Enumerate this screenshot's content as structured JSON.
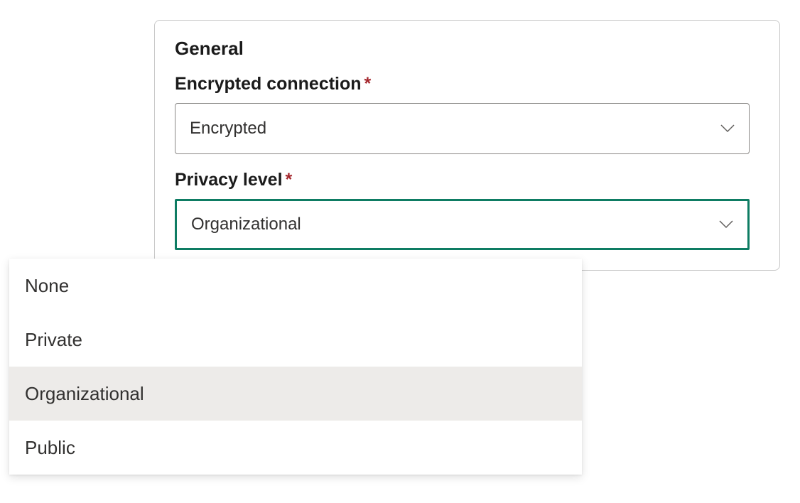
{
  "panel": {
    "section_title": "General",
    "encrypted_connection": {
      "label": "Encrypted connection",
      "required_mark": "*",
      "selected": "Encrypted"
    },
    "privacy_level": {
      "label": "Privacy level",
      "required_mark": "*",
      "selected": "Organizational",
      "options": [
        "None",
        "Private",
        "Organizational",
        "Public"
      ]
    }
  }
}
